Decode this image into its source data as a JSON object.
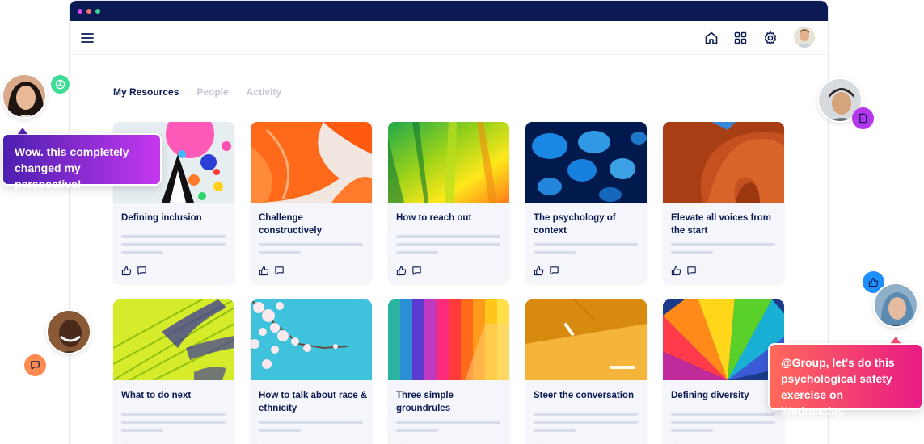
{
  "tabs": [
    {
      "label": "My Resources",
      "active": true
    },
    {
      "label": "People",
      "active": false
    },
    {
      "label": "Activity",
      "active": false
    }
  ],
  "toolbar": {
    "menu_icon": "hamburger-menu-icon",
    "home_icon": "home-icon",
    "apps_icon": "grid-icon",
    "settings_icon": "gear-icon"
  },
  "cards": [
    {
      "title": "Defining inclusion"
    },
    {
      "title": "Challenge constructively"
    },
    {
      "title": "How to reach out"
    },
    {
      "title": "The psychology of context"
    },
    {
      "title": "Elevate all voices from the start"
    },
    {
      "title": "What to do next"
    },
    {
      "title": "How to talk about race & ethnicity"
    },
    {
      "title": "Three simple groundrules"
    },
    {
      "title": "Steer the conversation"
    },
    {
      "title": "Defining diversity"
    }
  ],
  "bubbles": {
    "left": "Wow. this completely changed my perspective!",
    "right": "@Group, let's do this psychological safety exercise on Wednesday."
  },
  "colors": {
    "navy": "#0b1a52",
    "bubble_left_start": "#4b1fb0",
    "bubble_left_end": "#c638f0",
    "bubble_right_start": "#ff6a5a",
    "bubble_right_end": "#e81a84",
    "green_badge": "#3ddc97",
    "purple_badge": "#b636ee",
    "blue_badge": "#1e8fff",
    "orange_badge": "#ff8a50"
  }
}
